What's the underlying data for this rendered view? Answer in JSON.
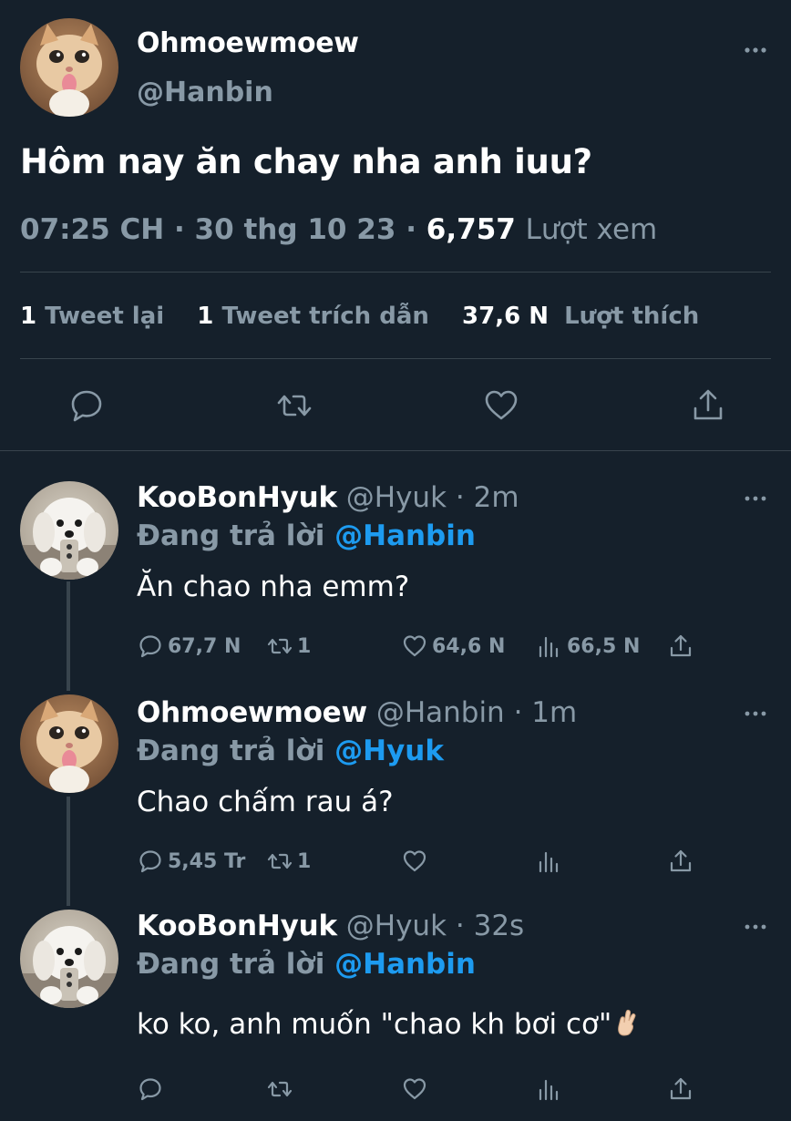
{
  "main_tweet": {
    "author_name": "Ohmoewmoew",
    "author_handle": "@Hanbin",
    "text": "Hôm nay ăn chay nha anh iuu?",
    "time": "07:25 CH",
    "sep1": "·",
    "date": "30 thg 10 23",
    "sep2": "·",
    "views_count": "6,757",
    "views_label": "Lượt xem",
    "retweets_count": "1",
    "retweets_label": "Tweet lại",
    "quotes_count": "1",
    "quotes_label": "Tweet trích dẫn",
    "likes_count": "37,6 N",
    "likes_label": "Lượt thích",
    "actions": [
      "reply-icon",
      "retweet-icon",
      "like-icon",
      "share-icon"
    ]
  },
  "replies": [
    {
      "author_name": "KooBonHyuk",
      "author_handle": "@Hyuk",
      "time": "· 2m",
      "replying_label": "Đang trả lời",
      "replying_to": "@Hanbin",
      "text": "Ăn chao nha emm?",
      "reply_count": "67,7 N",
      "retweet_count": "1",
      "like_count": "64,6 N",
      "view_count": "66,5 N"
    },
    {
      "author_name": "Ohmoewmoew",
      "author_handle": "@Hanbin",
      "time": "· 1m",
      "replying_label": "Đang trả lời",
      "replying_to": "@Hyuk",
      "text": "Chao chấm rau á?",
      "reply_count": "5,45 Tr",
      "retweet_count": "1",
      "like_count": "",
      "view_count": ""
    },
    {
      "author_name": "KooBonHyuk",
      "author_handle": "@Hyuk",
      "time": "· 32s",
      "replying_label": "Đang trả lời",
      "replying_to": "@Hanbin",
      "text": "ko ko, anh muốn \"chao kh bơi cơ\"",
      "reply_count": "",
      "retweet_count": "",
      "like_count": "",
      "view_count": ""
    }
  ],
  "colors": {
    "background": "#15202b",
    "text": "#ffffff",
    "muted": "#8899a6",
    "link": "#1d9bf0",
    "divider": "#38444d"
  }
}
